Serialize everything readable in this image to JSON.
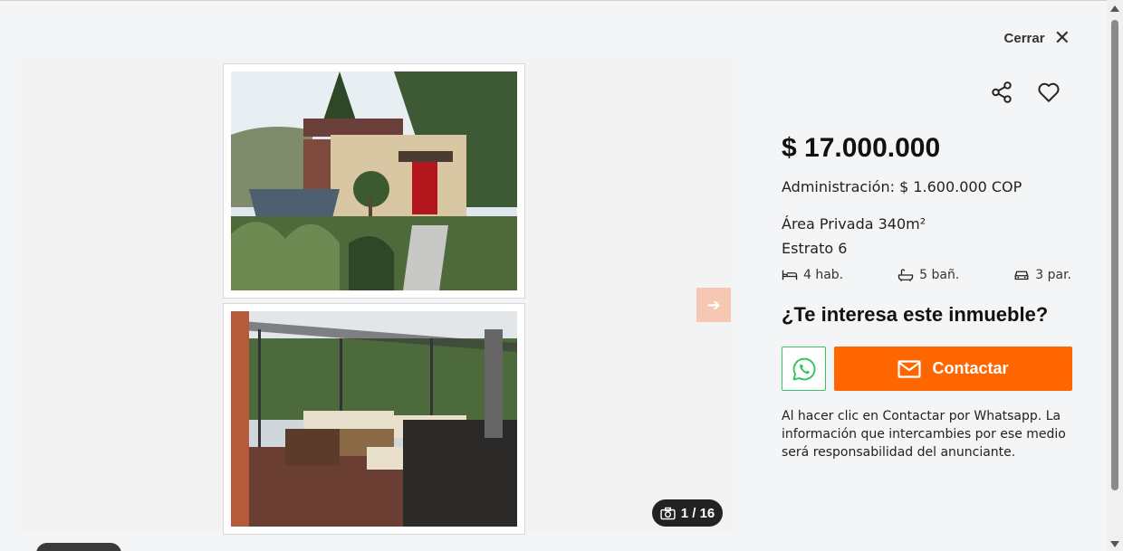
{
  "header": {
    "close_label": "Cerrar",
    "close_icon": "close-icon"
  },
  "gallery": {
    "counter_current": "1",
    "counter_total": "16",
    "counter_text": "1 / 16",
    "next_icon": "arrow-right-icon"
  },
  "listing": {
    "price": "$ 17.000.000",
    "administration": "Administración: $ 1.600.000 COP",
    "area": "Área Privada 340m²",
    "estrato": "Estrato 6",
    "features": {
      "rooms": "4 hab.",
      "baths": "5 bañ.",
      "parking": "3 par."
    },
    "interest_title": "¿Te interesa este inmueble?",
    "contact_label": "Contactar",
    "disclaimer": "Al hacer clic en Contactar por Whatsapp. La información que intercambies por ese medio será responsabilidad del anunciante."
  },
  "colors": {
    "accent": "#ff6600",
    "whatsapp": "#37c262",
    "arrow_bg": "#f6c8b3",
    "counter_bg": "#222222"
  }
}
